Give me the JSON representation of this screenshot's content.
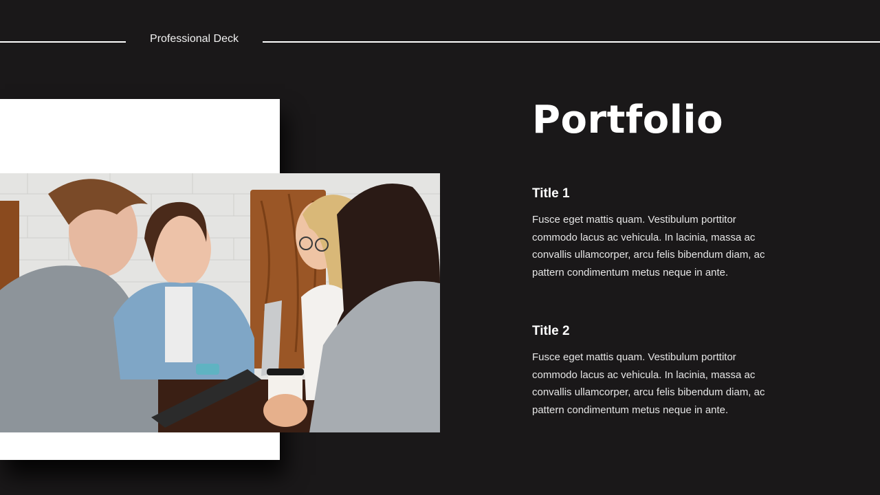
{
  "header": {
    "label": "Professional Deck"
  },
  "main": {
    "title": "Portfolio",
    "sections": [
      {
        "title": "Title 1",
        "body": "Fusce eget mattis quam. Vestibulum porttitor commodo lacus ac vehicula. In lacinia, massa ac convallis ullamcorper, arcu felis bibendum diam, ac pattern condimentum metus neque in ante."
      },
      {
        "title": "Title 2",
        "body": "Fusce eget mattis quam. Vestibulum porttitor commodo lacus ac vehicula. In lacinia, massa ac convallis ullamcorper, arcu felis bibendum diam, ac pattern condimentum metus neque in ante."
      }
    ]
  },
  "image": {
    "description": "Four young people smiling around a cafe table with a tablet, laptop and coffee cup"
  },
  "colors": {
    "background": "#1a1819",
    "text": "#ffffff",
    "card": "#ffffff"
  }
}
